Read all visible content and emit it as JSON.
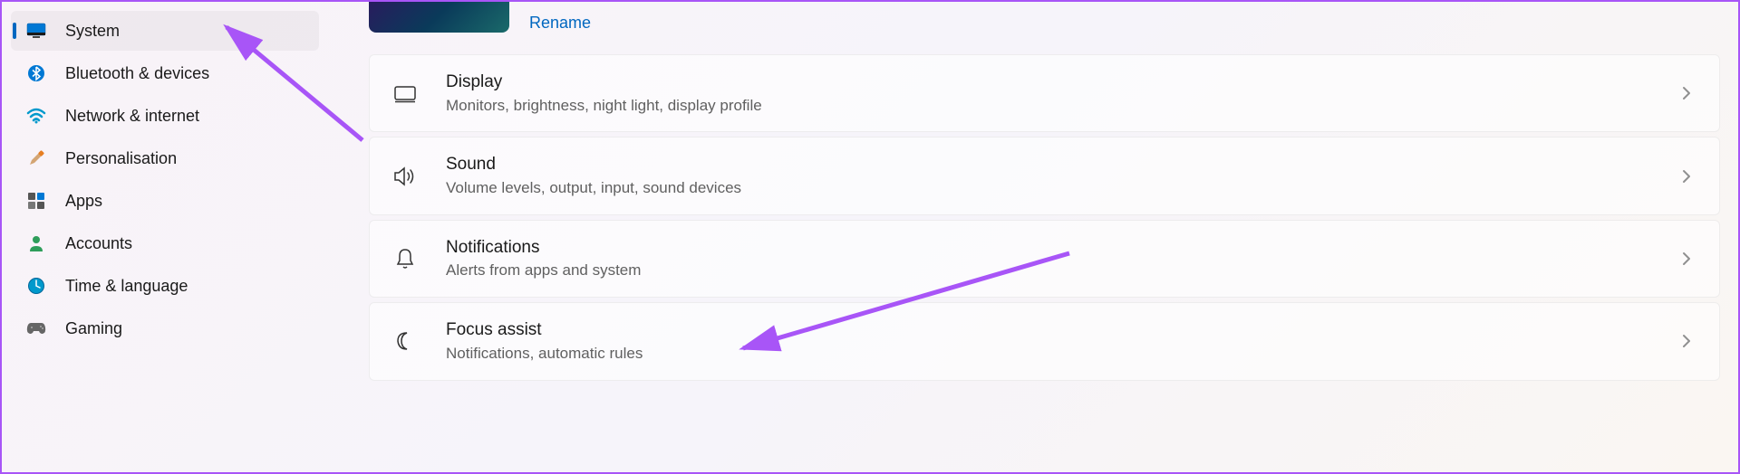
{
  "device": {
    "rename_label": "Rename"
  },
  "sidebar": {
    "items": [
      {
        "label": "System"
      },
      {
        "label": "Bluetooth & devices"
      },
      {
        "label": "Network & internet"
      },
      {
        "label": "Personalisation"
      },
      {
        "label": "Apps"
      },
      {
        "label": "Accounts"
      },
      {
        "label": "Time & language"
      },
      {
        "label": "Gaming"
      }
    ]
  },
  "cards": [
    {
      "title": "Display",
      "subtitle": "Monitors, brightness, night light, display profile"
    },
    {
      "title": "Sound",
      "subtitle": "Volume levels, output, input, sound devices"
    },
    {
      "title": "Notifications",
      "subtitle": "Alerts from apps and system"
    },
    {
      "title": "Focus assist",
      "subtitle": "Notifications, automatic rules"
    }
  ]
}
